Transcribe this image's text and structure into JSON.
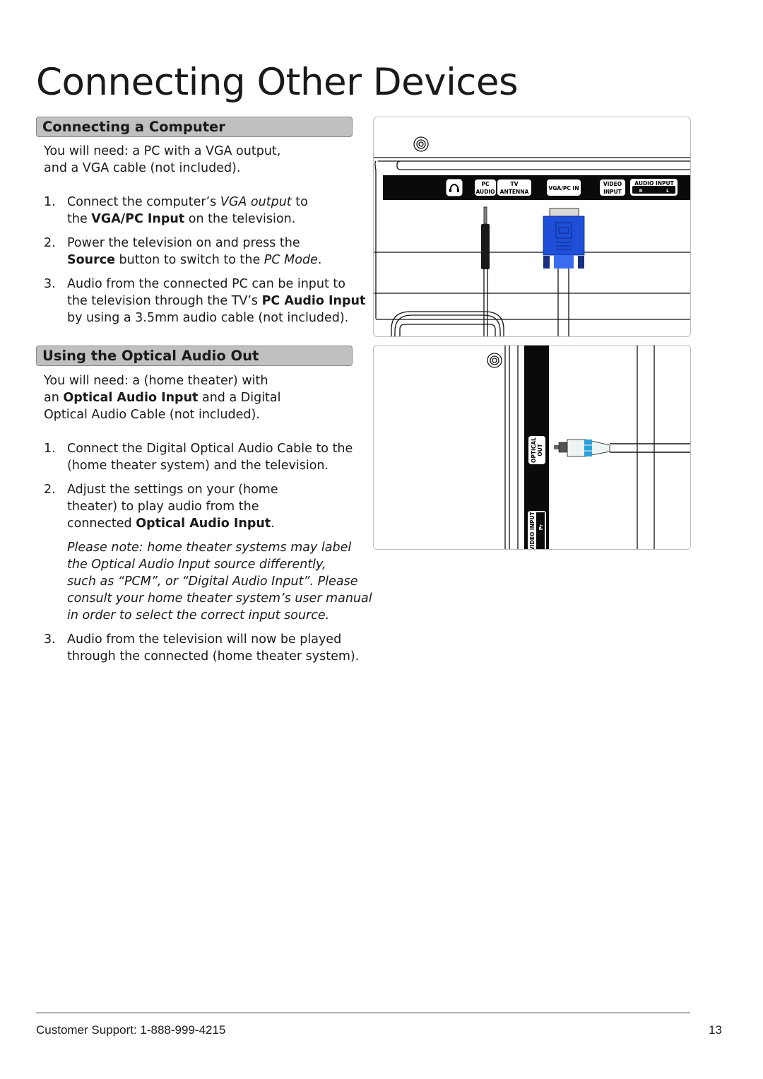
{
  "page_title": "Connecting Other Devices",
  "sections": [
    {
      "heading": "Connecting a Computer",
      "blocks": [
        {
          "kind": "intro",
          "lines": [
            [
              {
                "t": "You will need: a PC with a VGA output,"
              }
            ],
            [
              {
                "t": "and a VGA cable (not included)."
              }
            ]
          ]
        },
        {
          "kind": "item",
          "marker": "1.",
          "lines": [
            [
              {
                "t": "Connect the computer’s "
              },
              {
                "t": "VGA output",
                "i": true
              },
              {
                "t": " to"
              }
            ],
            [
              {
                "t": "the "
              },
              {
                "t": "VGA/PC Input",
                "b": true
              },
              {
                "t": " on the television."
              }
            ]
          ]
        },
        {
          "kind": "item",
          "marker": "2.",
          "lines": [
            [
              {
                "t": "Power the television on and press the"
              }
            ],
            [
              {
                "t": "Source",
                "b": true
              },
              {
                "t": " button to switch to the "
              },
              {
                "t": "PC Mode",
                "i": true
              },
              {
                "t": "."
              }
            ]
          ]
        },
        {
          "kind": "item",
          "marker": "3.",
          "lines": [
            [
              {
                "t": "Audio from the connected PC can be input to"
              }
            ],
            [
              {
                "t": "the television through the TV’s "
              },
              {
                "t": "PC Audio Input",
                "b": true
              }
            ],
            [
              {
                "t": "by using a 3.5mm audio cable (not included)."
              }
            ]
          ]
        }
      ]
    },
    {
      "heading": "Using the Optical Audio Out",
      "blocks": [
        {
          "kind": "intro",
          "lines": [
            [
              {
                "t": "You will need: a (home theater) with"
              }
            ],
            [
              {
                "t": "an "
              },
              {
                "t": "Optical Audio Input",
                "b": true
              },
              {
                "t": " and a Digital"
              }
            ],
            [
              {
                "t": "Optical Audio Cable (not included)."
              }
            ]
          ]
        },
        {
          "kind": "item",
          "marker": "1.",
          "lines": [
            [
              {
                "t": "Connect the Digital Optical Audio Cable to the"
              }
            ],
            [
              {
                "t": "(home theater system) and the television."
              }
            ]
          ]
        },
        {
          "kind": "item",
          "marker": "2.",
          "lines": [
            [
              {
                "t": "Adjust the settings on your (home"
              }
            ],
            [
              {
                "t": "theater) to play audio from the"
              }
            ],
            [
              {
                "t": "connected "
              },
              {
                "t": "Optical Audio Input",
                "b": true
              },
              {
                "t": "."
              }
            ]
          ]
        },
        {
          "kind": "note",
          "lines": [
            [
              {
                "t": "Please note: home theater systems may label",
                "i": true
              }
            ],
            [
              {
                "t": "the Optical Audio Input source differently,",
                "i": true
              }
            ],
            [
              {
                "t": "such as “PCM”, or “Digital Audio Input”. Please",
                "i": true
              }
            ],
            [
              {
                "t": "consult your home theater system’s user manual",
                "i": true
              }
            ],
            [
              {
                "t": "in order to select the correct input source.",
                "i": true
              }
            ]
          ]
        },
        {
          "kind": "item",
          "marker": "3.",
          "lines": [
            [
              {
                "t": "Audio from the television will now be played"
              }
            ],
            [
              {
                "t": "through the connected (home theater system)."
              }
            ]
          ]
        }
      ]
    }
  ],
  "figure_computer": {
    "ports": {
      "headphone_icon": "headphones-icon",
      "pc_audio": [
        "PC",
        "AUDIO"
      ],
      "tv_antenna": [
        "TV",
        "ANTENNA"
      ],
      "vga_pc_in": "VGA/PC IN",
      "video_input": [
        "VIDEO",
        "INPUT"
      ],
      "audio_input": "AUDIO INPUT",
      "audio_r": "R",
      "audio_l": "L"
    },
    "colors": {
      "vga_connector": "#1f4fd8",
      "panel": "#0a0a0a"
    }
  },
  "figure_optical": {
    "ports": {
      "optical_out": [
        "OPTICAL",
        "OUT"
      ],
      "video_input": "VIDEO INPUT",
      "pr": "Pr"
    },
    "colors": {
      "plug_band": "#2a9fd6"
    }
  },
  "footer": {
    "support": "Customer Support: 1-888-999-4215",
    "page_number": "13"
  }
}
